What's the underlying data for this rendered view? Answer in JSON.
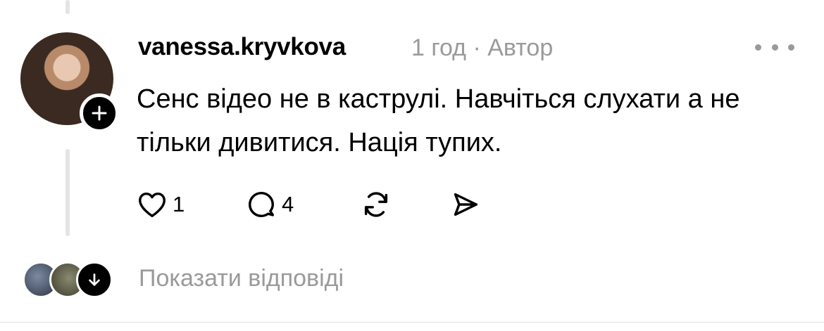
{
  "post": {
    "username": "vanessa.kryvkova",
    "meta": "1 год · Автор",
    "text": "Сенс відео не в каструлі. Навчіться слухати а не тільки дивитися. Нація тупих.",
    "likes": "1",
    "replies": "4"
  },
  "replies_footer": {
    "label": "Показати відповіді"
  },
  "icons": {
    "like": "heart-icon",
    "reply": "speech-bubble-icon",
    "repost": "repost-icon",
    "share": "send-icon",
    "more": "more-dots-icon",
    "follow": "plus-icon",
    "expand": "arrow-down-icon"
  }
}
